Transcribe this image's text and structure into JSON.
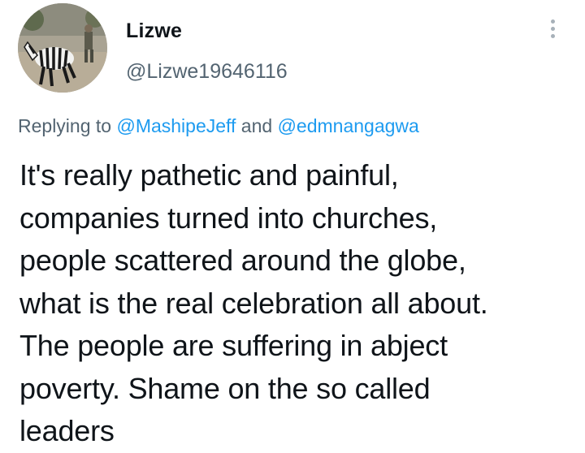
{
  "author": {
    "display_name": "Lizwe",
    "handle": "@Lizwe19646116",
    "avatar_icon": "avatar-zebra-photo"
  },
  "menu": {
    "icon": "more-vertical-icon"
  },
  "reply": {
    "prefix": "Replying to ",
    "mention_1": "@MashipeJeff",
    "joiner": " and ",
    "mention_2": "@edmnangagwa"
  },
  "tweet": {
    "text": "It's really pathetic and painful,\ncompanies turned into churches,\npeople scattered around the globe,\nwhat is the real celebration all about.\nThe people are suffering in abject\npoverty. Shame on the so called\nleaders"
  },
  "colors": {
    "accent": "#1d9bf0",
    "secondary_text": "#536471",
    "primary_text": "#0f1419"
  }
}
